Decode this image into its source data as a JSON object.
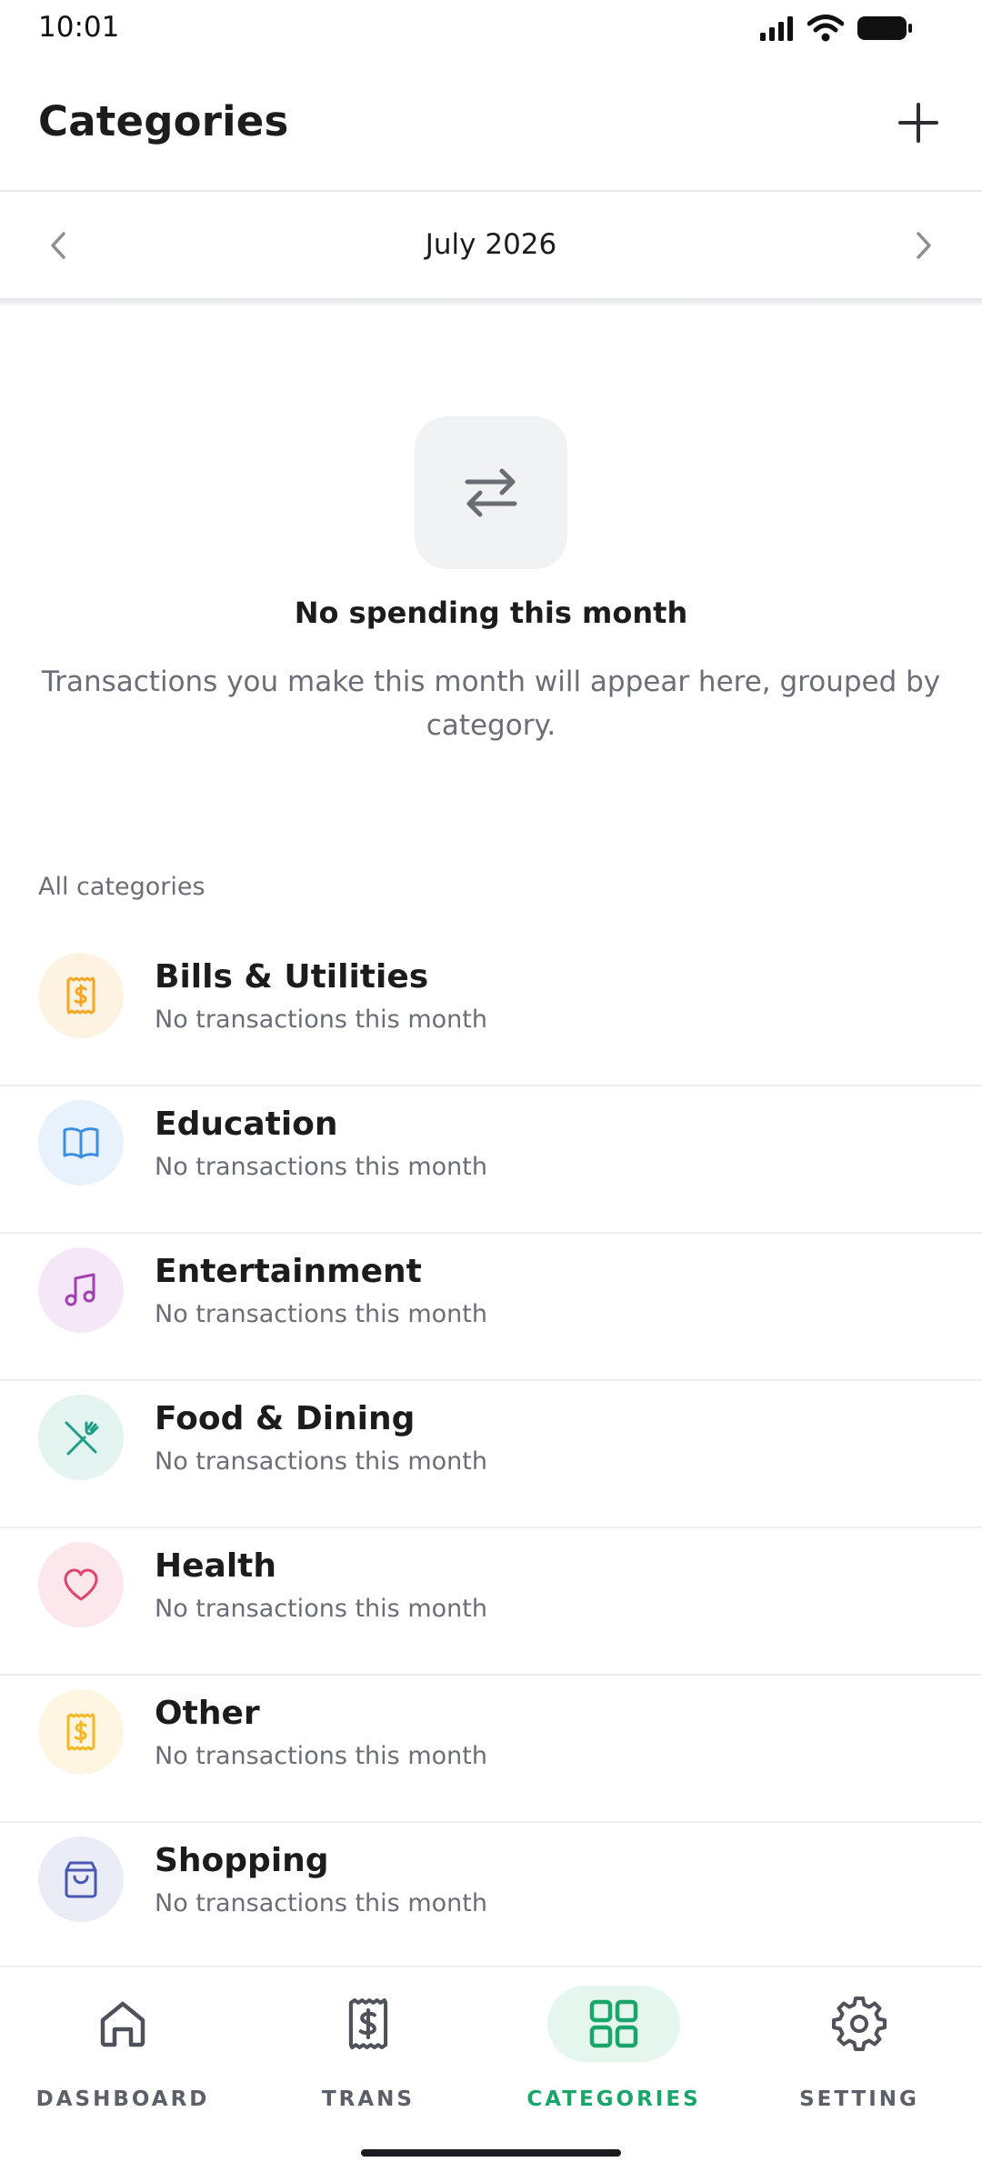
{
  "status_bar": {
    "time": "10:01",
    "icons": [
      "signal-icon",
      "wifi-icon",
      "battery-icon"
    ]
  },
  "header": {
    "title": "Categories",
    "add_icon": "plus-icon"
  },
  "month_selector": {
    "label": "July 2026",
    "prev_icon": "chevron-left-icon",
    "next_icon": "chevron-right-icon"
  },
  "empty_state": {
    "icon": "swap-arrows-icon",
    "title": "No spending this month",
    "description": "Transactions you make this month will appear here, grouped by category."
  },
  "categories": {
    "section_label": "All categories",
    "items": [
      {
        "name": "Bills & Utilities",
        "subtitle": "No transactions this month",
        "icon": "receipt-icon",
        "color": "#f5a623",
        "bg": "#fef3e2"
      },
      {
        "name": "Education",
        "subtitle": "No transactions this month",
        "icon": "book-icon",
        "color": "#3b8fe0",
        "bg": "#e7f2fd"
      },
      {
        "name": "Entertainment",
        "subtitle": "No transactions this month",
        "icon": "music-note-icon",
        "color": "#a23fb0",
        "bg": "#f5e7f7"
      },
      {
        "name": "Food & Dining",
        "subtitle": "No transactions this month",
        "icon": "utensils-icon",
        "color": "#1f9e87",
        "bg": "#e3f4f1"
      },
      {
        "name": "Health",
        "subtitle": "No transactions this month",
        "icon": "heart-icon",
        "color": "#e2456b",
        "bg": "#fce7ed"
      },
      {
        "name": "Other",
        "subtitle": "No transactions this month",
        "icon": "receipt-icon",
        "color": "#f5b823",
        "bg": "#fef6e2"
      },
      {
        "name": "Shopping",
        "subtitle": "No transactions this month",
        "icon": "shopping-bag-icon",
        "color": "#4a58b3",
        "bg": "#eaecf6"
      }
    ]
  },
  "bottom_nav": {
    "items": [
      {
        "label": "DASHBOARD",
        "icon": "home-icon",
        "active": false
      },
      {
        "label": "TRANS",
        "icon": "receipt-icon",
        "active": false
      },
      {
        "label": "CATEGORIES",
        "icon": "grid-icon",
        "active": true
      },
      {
        "label": "SETTING",
        "icon": "gear-icon",
        "active": false
      }
    ],
    "accent_color": "#1aa66a"
  }
}
